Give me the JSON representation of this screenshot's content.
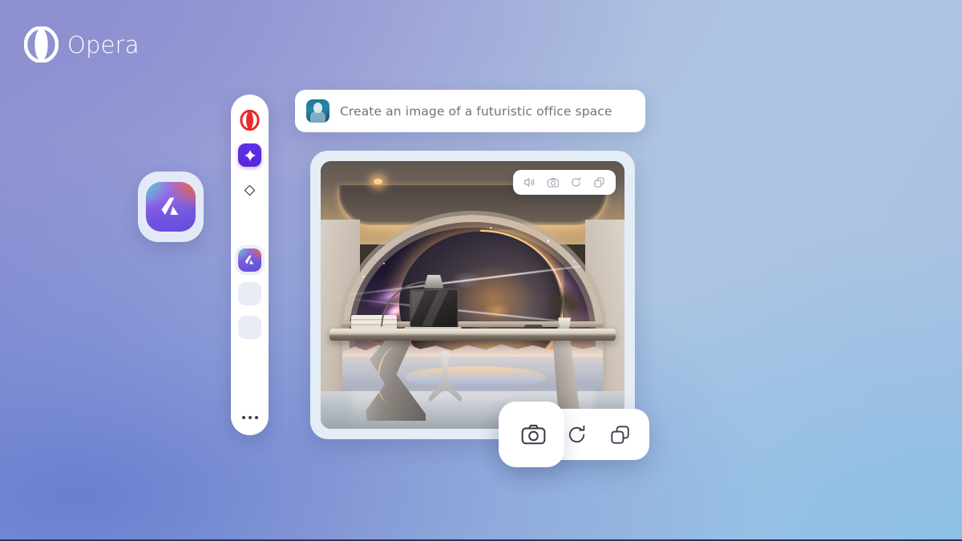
{
  "brand": {
    "name": "Opera",
    "logo_icon": "opera-o-icon",
    "logo_color": "#ffffff"
  },
  "background": {
    "gradient_from": "#8f8fd2",
    "gradient_mid": "#aec6e2",
    "gradient_to": "#8cc0e6"
  },
  "app_icon": {
    "name": "aria-app-icon",
    "gradient_colors": [
      "#4ecbd0",
      "#f4663a",
      "#8a63e4",
      "#5d4ada"
    ],
    "glyph": "a-mark-glyph"
  },
  "sidebar": {
    "items": [
      {
        "id": "opera-home",
        "icon": "opera-o-icon",
        "label": "Opera",
        "color": "#e8282b"
      },
      {
        "id": "aria-assistant",
        "icon": "sparkle-icon",
        "label": "Aria",
        "color": "#5426d8",
        "active": true
      },
      {
        "id": "diamond-tool",
        "icon": "diamond-icon",
        "label": "Diamond",
        "color": "#3a3f52"
      },
      {
        "id": "pinned-app",
        "icon": "aria-app-icon",
        "label": "App"
      },
      {
        "id": "placeholder-1",
        "icon": "empty-slot-icon",
        "label": ""
      },
      {
        "id": "placeholder-2",
        "icon": "empty-slot-icon",
        "label": ""
      }
    ],
    "more_label": "more-options-icon"
  },
  "prompt": {
    "avatar_icon": "user-avatar",
    "text": "Create an image of a futuristic office space",
    "placeholder": "Create an image of a futuristic office space"
  },
  "result": {
    "image_alt": "futuristic office space with arched window showing a planet and galaxy",
    "toolbar_small": [
      {
        "id": "read-aloud",
        "icon": "speaker-icon",
        "label": "Read aloud"
      },
      {
        "id": "snapshot",
        "icon": "camera-icon",
        "label": "Snapshot"
      },
      {
        "id": "regenerate",
        "icon": "refresh-icon",
        "label": "Regenerate"
      },
      {
        "id": "copy",
        "icon": "copy-icon",
        "label": "Copy"
      }
    ],
    "toolbar_big": [
      {
        "id": "snapshot",
        "icon": "camera-icon",
        "label": "Snapshot",
        "highlighted": true
      },
      {
        "id": "regenerate",
        "icon": "refresh-icon",
        "label": "Regenerate"
      },
      {
        "id": "copy",
        "icon": "copy-icon",
        "label": "Copy"
      }
    ]
  }
}
